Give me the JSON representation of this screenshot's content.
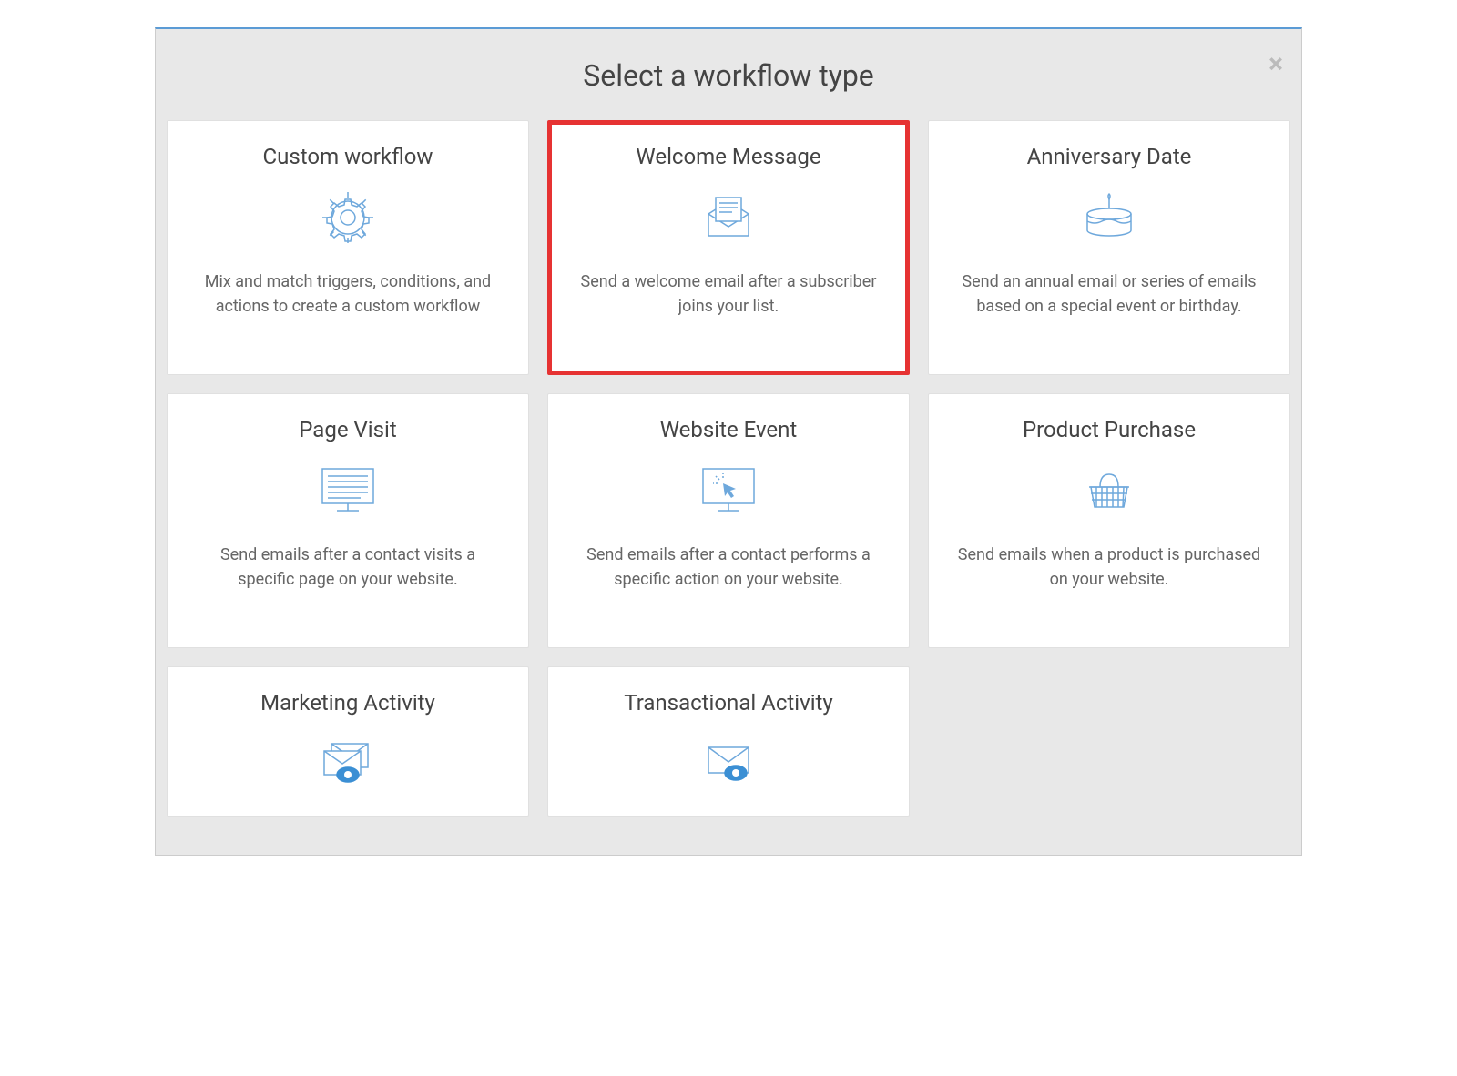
{
  "modal": {
    "title": "Select a workflow type",
    "close_label": "×"
  },
  "cards": [
    {
      "title": "Custom workflow",
      "description": "Mix and match triggers, conditions, and actions to create a custom workflow",
      "icon": "gear-icon",
      "highlighted": false
    },
    {
      "title": "Welcome Message",
      "description": "Send a welcome email after a subscriber joins your list.",
      "icon": "welcome-envelope-icon",
      "highlighted": true
    },
    {
      "title": "Anniversary Date",
      "description": "Send an annual email or series of emails based on a special event or birthday.",
      "icon": "cake-icon",
      "highlighted": false
    },
    {
      "title": "Page Visit",
      "description": "Send emails after a contact visits a specific page on your website.",
      "icon": "page-monitor-icon",
      "highlighted": false
    },
    {
      "title": "Website Event",
      "description": "Send emails after a contact performs a specific action on your website.",
      "icon": "event-monitor-icon",
      "highlighted": false
    },
    {
      "title": "Product Purchase",
      "description": "Send emails when a product is purchased on your website.",
      "icon": "basket-icon",
      "highlighted": false
    },
    {
      "title": "Marketing Activity",
      "description": "",
      "icon": "marketing-envelope-icon",
      "highlighted": false
    },
    {
      "title": "Transactional Activity",
      "description": "",
      "icon": "transactional-envelope-icon",
      "highlighted": false
    }
  ]
}
